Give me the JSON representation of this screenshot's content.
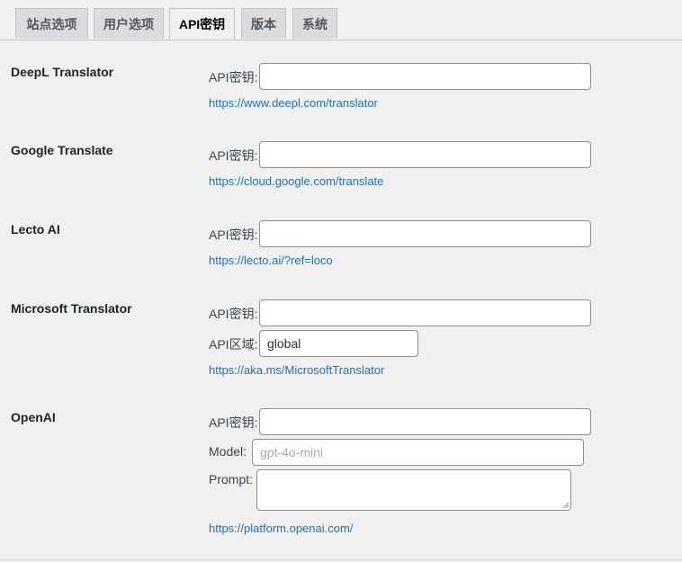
{
  "tabs": [
    {
      "label": "站点选项",
      "active": false
    },
    {
      "label": "用户选项",
      "active": false
    },
    {
      "label": "API密钥",
      "active": true
    },
    {
      "label": "版本",
      "active": false
    },
    {
      "label": "系统",
      "active": false
    }
  ],
  "sections": {
    "deepl": {
      "title": "DeepL Translator",
      "api_key_label": "API密钥:",
      "api_key_value": "",
      "link": "https://www.deepl.com/translator"
    },
    "google": {
      "title": "Google Translate",
      "api_key_label": "API密钥:",
      "api_key_value": "",
      "link": "https://cloud.google.com/translate"
    },
    "lecto": {
      "title": "Lecto AI",
      "api_key_label": "API密钥:",
      "api_key_value": "",
      "link": "https://lecto.ai/?ref=loco"
    },
    "microsoft": {
      "title": "Microsoft Translator",
      "api_key_label": "API密钥:",
      "api_key_value": "",
      "region_label": "API区域:",
      "region_value": "global",
      "link": "https://aka.ms/MicrosoftTranslator"
    },
    "openai": {
      "title": "OpenAI",
      "api_key_label": "API密钥:",
      "api_key_value": "",
      "model_label": "Model:",
      "model_placeholder": "gpt-4o-mini",
      "prompt_label": "Prompt:",
      "prompt_value": "",
      "link": "https://platform.openai.com/"
    }
  }
}
